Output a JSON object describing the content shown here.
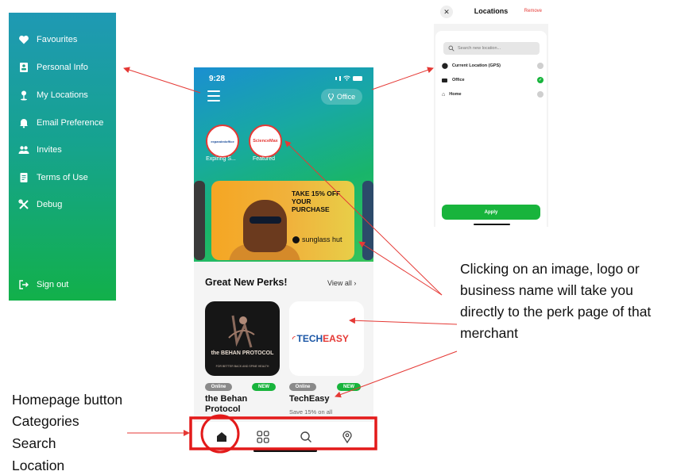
{
  "side_menu": {
    "items": [
      {
        "label": "Favourites",
        "icon": "heart-icon"
      },
      {
        "label": "Personal Info",
        "icon": "id-card-icon"
      },
      {
        "label": "My Locations",
        "icon": "map-pin-icon"
      },
      {
        "label": "Email Preference",
        "icon": "bell-icon"
      },
      {
        "label": "Invites",
        "icon": "people-icon"
      },
      {
        "label": "Terms of Use",
        "icon": "document-icon"
      },
      {
        "label": "Debug",
        "icon": "tools-icon"
      }
    ],
    "sign_out": "Sign out"
  },
  "phone": {
    "status_time": "9:28",
    "location_pill": "Office",
    "stories": [
      {
        "label": "Expiring S...",
        "logo_text": "expandedoffice"
      },
      {
        "label": "Featured",
        "logo_text": "ScienceMax"
      }
    ],
    "banner": {
      "headline": "TAKE 15% OFF YOUR PURCHASE",
      "brand": "sunglass hut"
    },
    "section_title": "Great New Perks!",
    "view_all": "View all",
    "perks": [
      {
        "name": "the Behan Protocol",
        "tag_online": "Online",
        "tag_new": "NEW",
        "logo_title": "the BEHAN PROTOCOL",
        "logo_sub": "FOR BETTER BACK AND SPINE HEALTH"
      },
      {
        "name": "TechEasy",
        "tag_online": "Online",
        "tag_new": "NEW",
        "subtitle": "Save 15% on all",
        "logo_a": "TECH",
        "logo_b": "EASY"
      }
    ],
    "nav": [
      "home-icon",
      "categories-icon",
      "search-icon",
      "location-icon"
    ]
  },
  "locations_screen": {
    "title": "Locations",
    "remove": "Remove",
    "search_placeholder": "Search new location...",
    "rows": [
      {
        "label": "Current Location (GPS)",
        "icon": "pin-icon",
        "selected": false
      },
      {
        "label": "Office",
        "icon": "briefcase-icon",
        "selected": true
      },
      {
        "label": "Home",
        "icon": "house-icon",
        "selected": false
      }
    ],
    "apply": "Apply"
  },
  "annotations": {
    "callout": "Clicking on an image, logo or business name will take you directly to the perk page of that merchant",
    "legend": [
      "Homepage button",
      "Categories",
      "Search",
      "Location"
    ]
  },
  "colors": {
    "accent_green": "#18b43c",
    "annotation_red": "#e53935",
    "tag_grey": "#8a8a8a"
  }
}
